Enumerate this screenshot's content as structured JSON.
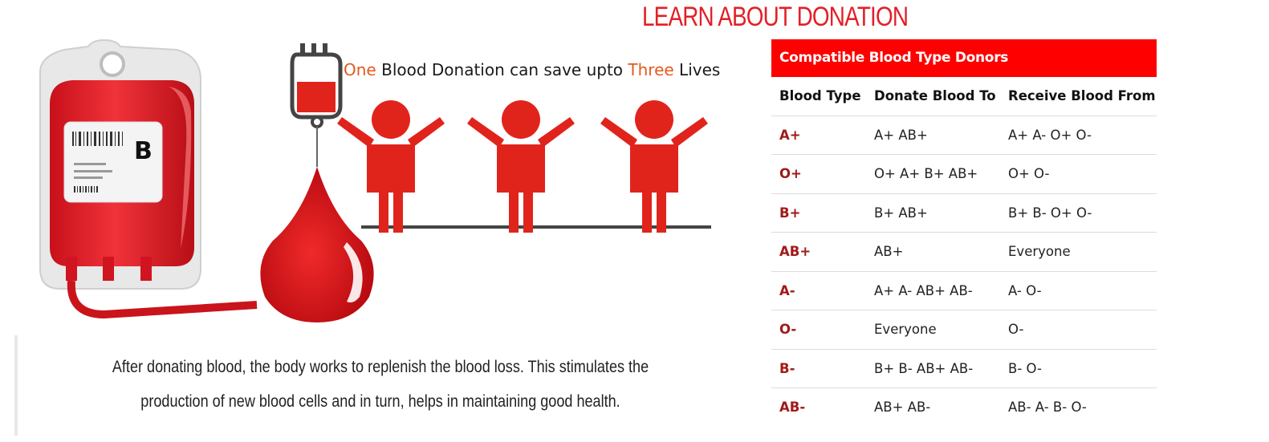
{
  "page": {
    "title": "LEARN ABOUT DONATION"
  },
  "illustration": {
    "bag_label": "B",
    "headline_parts": [
      "One",
      " Blood Donation can save upto ",
      "Three",
      " Lives"
    ],
    "accent_color": "#e35a1e",
    "blood_red": "#e0241c"
  },
  "caption": "After donating blood, the body works to replenish the blood loss. This stimulates the production of new blood cells and in turn, helps in maintaining good health.",
  "table": {
    "title": "Compatible Blood Type Donors",
    "header_color": "#fe0000",
    "columns": [
      "Blood Type",
      "Donate Blood To",
      "Receive Blood From"
    ],
    "rows": [
      [
        "A+",
        "A+ AB+",
        "A+ A- O+ O-"
      ],
      [
        "O+",
        "O+ A+ B+ AB+",
        "O+ O-"
      ],
      [
        "B+",
        "B+ AB+",
        "B+ B- O+ O-"
      ],
      [
        "AB+",
        "AB+",
        "Everyone"
      ],
      [
        "A-",
        "A+ A- AB+ AB-",
        "A- O-"
      ],
      [
        "O-",
        "Everyone",
        "O-"
      ],
      [
        "B-",
        "B+ B- AB+ AB-",
        "B- O-"
      ],
      [
        "AB-",
        "AB+ AB-",
        "AB- A- B- O-"
      ]
    ]
  }
}
